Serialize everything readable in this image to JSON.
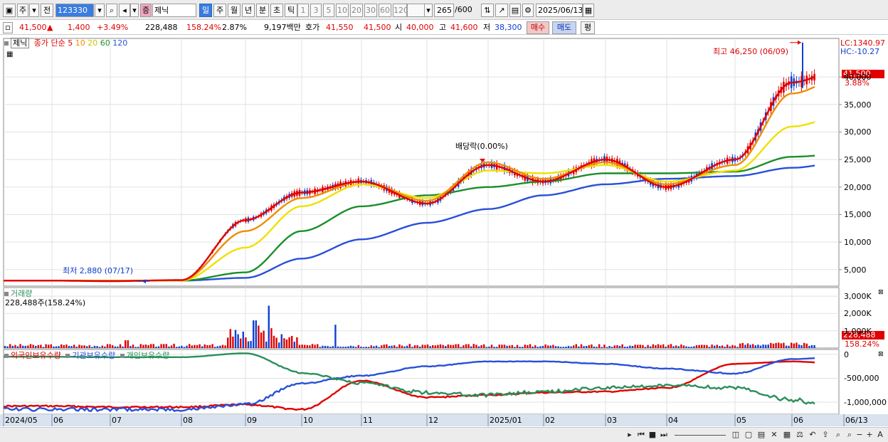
{
  "toolbar": {
    "market_type": "주",
    "prev_label": "전",
    "code": "123330",
    "stock_badge": "증",
    "stock_name": "제닉",
    "periods": [
      "일",
      "주",
      "월",
      "년",
      "분",
      "초",
      "틱"
    ],
    "active_period": "일",
    "intervals": [
      "1",
      "3",
      "5",
      "10",
      "20",
      "30",
      "60",
      "120"
    ],
    "count": "265",
    "count_max": "/600",
    "date": "2025/06/13"
  },
  "quote": {
    "price": "41,500",
    "arrow": "▲",
    "change": "1,400",
    "change_pct": "+3.49%",
    "volume": "228,488",
    "volume_ratio": "158.24%",
    "turnover_rate": "2.87%",
    "amount": "9,197백만",
    "bid_label": "호가",
    "ask": "41,550",
    "bid": "41,500",
    "open_label": "시",
    "open": "40,000",
    "high_label": "고",
    "high": "41,600",
    "low_label": "저",
    "low": "38,300",
    "buy_label": "매수",
    "sell_label": "매도",
    "eval_label": "평"
  },
  "legend": {
    "name": "제닉",
    "ma_label": "종가 단순",
    "ma_periods": [
      "5",
      "10",
      "20",
      "60",
      "120"
    ],
    "ma_colors": [
      "#e00000",
      "#f08c00",
      "#f0e000",
      "#1a8f2a",
      "#2850d8"
    ]
  },
  "annotations": {
    "high": "최고 46,250 (06/09)",
    "low": "최저 2,880 (07/17)",
    "dividend": "배당락(0.00%)",
    "lc": "LC:1340.97",
    "hc": "HC:-10.27",
    "current_tag": "41,500",
    "current_pct": "3.88%"
  },
  "volume_panel": {
    "title": "거래량",
    "value": "228,488주(158.24%)",
    "tag": "228,488",
    "pct": "158.24%"
  },
  "holdings_panel": {
    "titles": [
      "외국인보유수량",
      "기관보유수량",
      "개인보유수량"
    ],
    "colors": [
      "#e00000",
      "#2850d8",
      "#2a8f5a"
    ]
  },
  "chart_data": {
    "type": "line",
    "panels": [
      {
        "name": "price",
        "ylim": [
          2000,
          47000
        ],
        "yticks": [
          "5,000",
          "10,000",
          "15,000",
          "20,000",
          "25,000",
          "30,000",
          "35,000",
          "40,000"
        ],
        "x": [
          "2024/05",
          "2024/06",
          "2024/07",
          "2024/08",
          "2024/09",
          "2024/10",
          "2024/11",
          "2024/12",
          "2025/01",
          "2025/02",
          "2025/03",
          "2025/04",
          "2025/05",
          "2025/06",
          "2025/06/13"
        ],
        "series": [
          {
            "name": "5",
            "values": [
              3000,
              3000,
              2900,
              3100,
              14000,
              19000,
              21000,
              17000,
              24000,
              21000,
              25000,
              20000,
              25000,
              39000,
              41500
            ]
          },
          {
            "name": "10",
            "values": [
              3000,
              3000,
              2950,
              3050,
              12000,
              18000,
              21000,
              17500,
              24500,
              21500,
              24500,
              20500,
              24000,
              37000,
              40000
            ]
          },
          {
            "name": "20",
            "values": [
              3000,
              3000,
              3000,
              3000,
              9000,
              16500,
              20500,
              18000,
              23000,
              22500,
              24000,
              21000,
              23000,
              31000,
              33000
            ]
          },
          {
            "name": "60",
            "values": [
              3000,
              3000,
              3000,
              3000,
              4500,
              12000,
              16500,
              18500,
              20000,
              21000,
              22500,
              22500,
              22800,
              25500,
              26000
            ]
          },
          {
            "name": "120",
            "values": [
              3000,
              3000,
              3000,
              3000,
              3500,
              7000,
              10500,
              13500,
              16000,
              18500,
              20500,
              21500,
              22000,
              23500,
              24500
            ]
          }
        ]
      },
      {
        "name": "volume",
        "ylim": [
          0,
          3500000
        ],
        "yticks": [
          "1,000K",
          "2,000K",
          "3,000K"
        ]
      },
      {
        "name": "holdings",
        "ylim": [
          -1250000,
          100000
        ],
        "yticks": [
          "0",
          "-500,000",
          "-1,000,000"
        ],
        "series": [
          {
            "name": "외국인보유수량",
            "values": [
              -1080000,
              -1080000,
              -1100000,
              -1100000,
              -1050000,
              -1150000,
              -550000,
              -900000,
              -850000,
              -800000,
              -780000,
              -700000,
              -200000,
              -150000,
              -200000
            ]
          },
          {
            "name": "기관보유수량",
            "values": [
              -1150000,
              -1150000,
              -1150000,
              -1150000,
              -1050000,
              -600000,
              -450000,
              -250000,
              -150000,
              -150000,
              -200000,
              -300000,
              -400000,
              -100000,
              -50000
            ]
          },
          {
            "name": "개인보유수량",
            "values": [
              -50000,
              -50000,
              -60000,
              -60000,
              20000,
              -380000,
              -600000,
              -800000,
              -850000,
              -780000,
              -700000,
              -650000,
              -700000,
              -950000,
              -1150000
            ]
          }
        ]
      }
    ],
    "last_date_label": "06/13"
  }
}
